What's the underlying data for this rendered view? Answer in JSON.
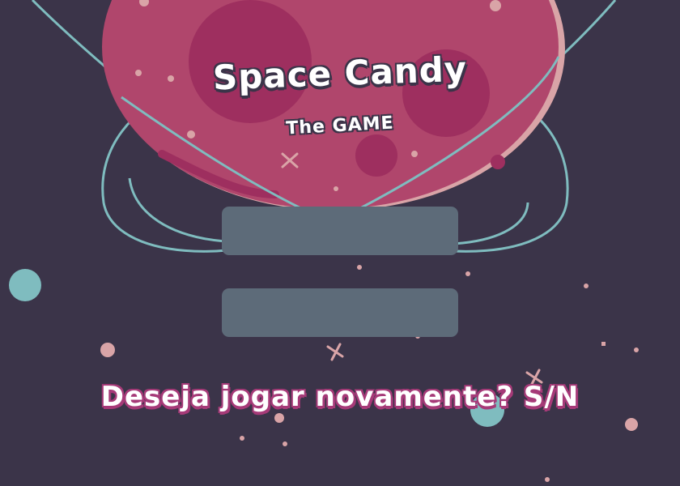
{
  "game": {
    "title": "Space Candy",
    "subtitle": "The GAME",
    "prompt": "Deseja jogar novamente? S/N"
  },
  "menu": {
    "button_1_label": "",
    "button_2_label": ""
  },
  "colors": {
    "background": "#3b3449",
    "planet": "#b0466c",
    "planet_crater": "#9e2f5f",
    "orbit": "#7fbcbf",
    "button": "#5d6b79",
    "prompt_outline": "#a63a78",
    "star_pink": "#d9a4a7",
    "moon_teal": "#7fbcbf"
  }
}
